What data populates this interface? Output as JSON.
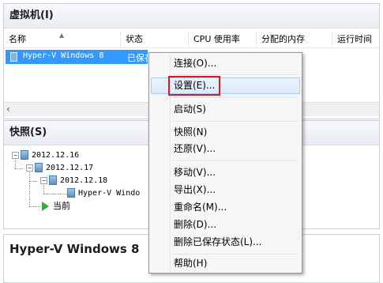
{
  "vm_panel": {
    "title": "虚拟机(I)",
    "columns": [
      "名称",
      "状态",
      "CPU 使用率",
      "分配的内存",
      "运行时间"
    ],
    "row": {
      "name": "Hyper-V Windows  8",
      "state": "已保存"
    }
  },
  "snapshot_panel": {
    "title": "快照(S)",
    "nodes": [
      "2012.12.16",
      "2012.12.17",
      "2012.12.18",
      "Hyper-V Windo"
    ],
    "current": "当前"
  },
  "hv_panel": {
    "title": "Hyper-V Windows  8"
  },
  "context_menu": {
    "items": [
      "连接(O)...",
      "设置(E)...",
      "启动(S)",
      "快照(N)",
      "还原(V)...",
      "移动(V)...",
      "导出(X)...",
      "重命名(M)...",
      "删除(D)...",
      "删除已保存状态(L)...",
      "帮助(H)"
    ],
    "highlighted": "设置(E)...",
    "highlight_box_color": "#e3151e"
  },
  "colors": {
    "selection": "#3399ff",
    "menu_hover_border": "#a8cbf1"
  }
}
